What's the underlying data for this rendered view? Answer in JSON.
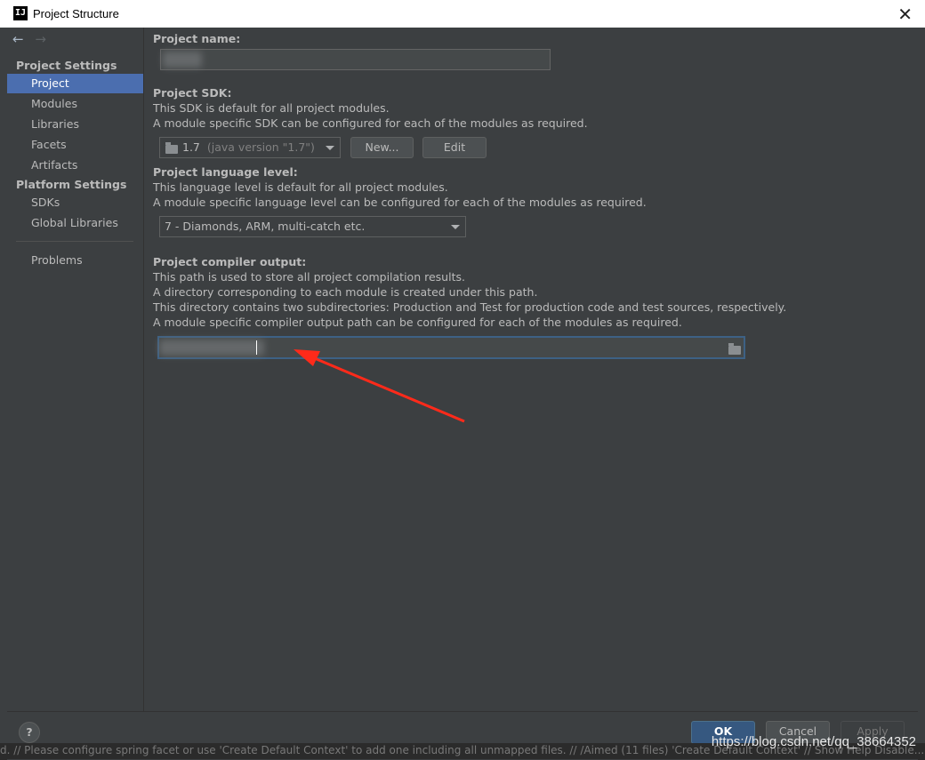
{
  "window": {
    "title": "Project Structure",
    "app_icon": "IJ"
  },
  "nav": {
    "back_icon": "←",
    "forward_icon": "→"
  },
  "sidebar": {
    "project_settings_header": "Project Settings",
    "project_settings_items": [
      "Project",
      "Modules",
      "Libraries",
      "Facets",
      "Artifacts"
    ],
    "platform_settings_header": "Platform Settings",
    "platform_settings_items": [
      "SDKs",
      "Global Libraries"
    ],
    "problems": "Problems",
    "selected": "Project"
  },
  "main": {
    "project_name": {
      "label": "Project name:",
      "value": ""
    },
    "sdk": {
      "label": "Project SDK:",
      "desc1": "This SDK is default for all project modules.",
      "desc2": "A module specific SDK can be configured for each of the modules as required.",
      "selected_version": "1.7",
      "selected_detail": "(java version \"1.7\")",
      "new_button": "New...",
      "edit_button": "Edit"
    },
    "language_level": {
      "label": "Project language level:",
      "desc1": "This language level is default for all project modules.",
      "desc2": "A module specific language level can be configured for each of the modules as required.",
      "selected": "7 - Diamonds, ARM, multi-catch etc."
    },
    "compiler_output": {
      "label": "Project compiler output:",
      "desc1": "This path is used to store all project compilation results.",
      "desc2": "A directory corresponding to each module is created under this path.",
      "desc3": "This directory contains two subdirectories: Production and Test for production code and test sources, respectively.",
      "desc4": "A module specific compiler output path can be configured for each of the modules as required.",
      "value": ""
    }
  },
  "footer": {
    "help": "?",
    "ok": "OK",
    "cancel": "Cancel",
    "apply": "Apply"
  },
  "statusbar": {
    "text": "d.  //  Please configure spring facet or use 'Create Default Context' to add one including all unmapped files.  //  /Aimed (11 files)  'Create Default Context'  //  Show Help Disable... ("
  },
  "watermark": "https://blog.csdn.net/qq_38664352",
  "colors": {
    "accent": "#4b6eaf",
    "arrow": "#ff2a1a",
    "background": "#3c3f41"
  }
}
